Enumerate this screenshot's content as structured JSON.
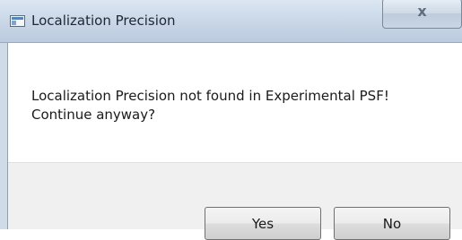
{
  "window": {
    "title": "Localization Precision",
    "close_glyph": "x"
  },
  "dialog": {
    "message_line1": "Localization Precision not found in Experimental PSF!",
    "message_line2": "Continue anyway?"
  },
  "buttons": {
    "yes_label": "Yes",
    "no_label": "No"
  },
  "colors": {
    "titlebar": "#c8d6e6",
    "content_background": "#ffffff",
    "footer_background": "#f0f0f0"
  },
  "icons": {
    "title_icon": "window-app-icon",
    "close_icon": "close-icon"
  }
}
